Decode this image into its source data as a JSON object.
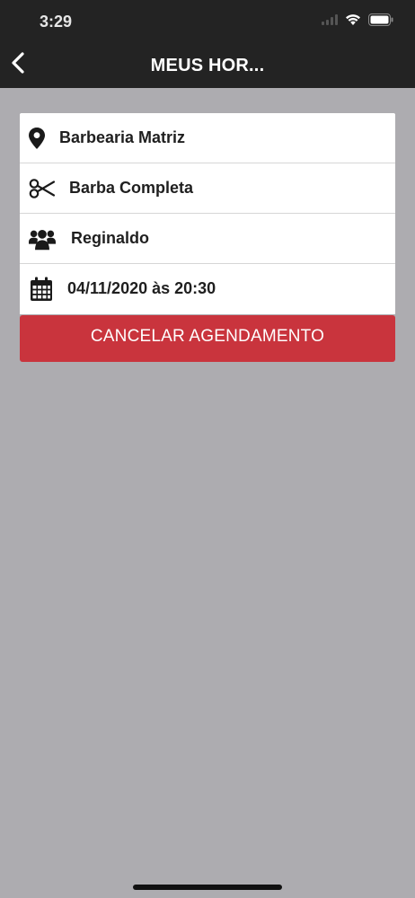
{
  "status_bar": {
    "time": "3:29",
    "icons": [
      "signal-icon",
      "wifi-icon",
      "battery-icon"
    ]
  },
  "nav": {
    "title": "MEUS HOR...",
    "back_icon": "chevron-left-icon"
  },
  "appointment": {
    "items": [
      {
        "icon": "location-pin-icon",
        "label": "Barbearia Matriz"
      },
      {
        "icon": "scissors-icon",
        "label": "Barba Completa"
      },
      {
        "icon": "users-icon",
        "label": "Reginaldo"
      },
      {
        "icon": "calendar-icon",
        "label": "04/11/2020 às 20:30"
      }
    ]
  },
  "actions": {
    "cancel_label": "CANCELAR AGENDAMENTO"
  },
  "colors": {
    "bar_background": "#232323",
    "page_background": "#adacb0",
    "cancel_button": "#c9343d"
  }
}
